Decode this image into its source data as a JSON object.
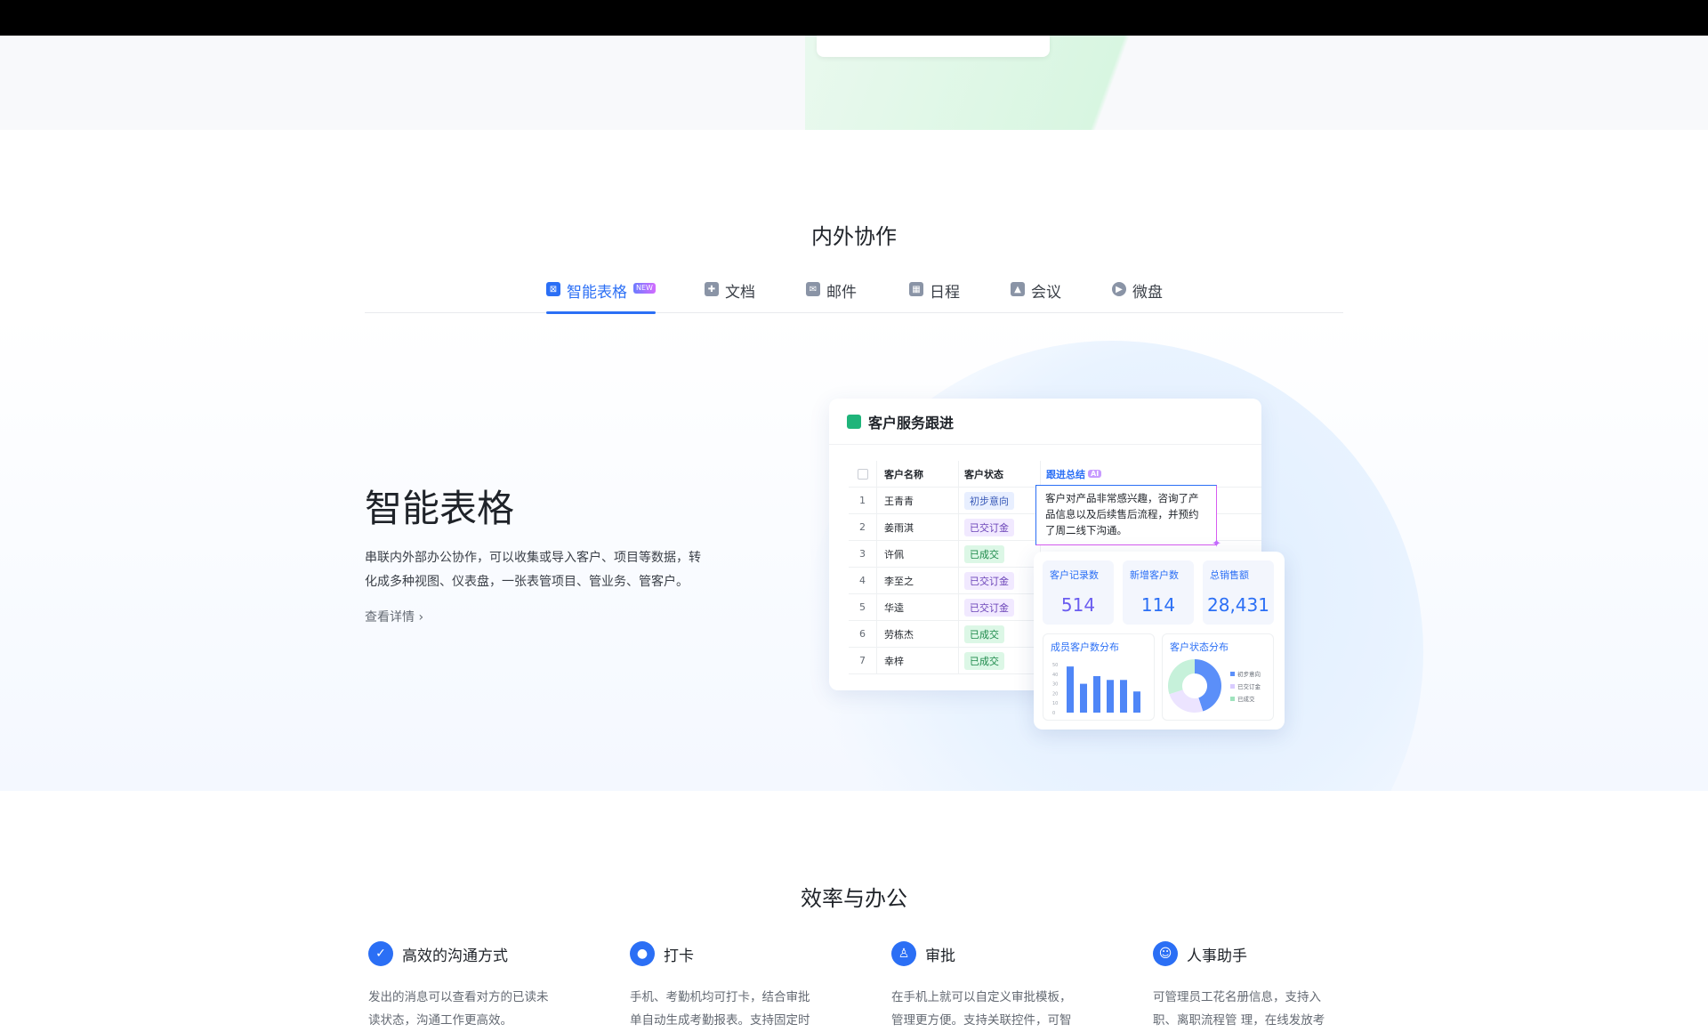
{
  "section1": {
    "title": "内外协作"
  },
  "tabs": [
    {
      "label": "智能表格",
      "badge": "NEW",
      "icon": "smart-sheet-icon",
      "color": "#2b6ff5"
    },
    {
      "label": "文档",
      "icon": "doc-icon",
      "color": "#8a94a6"
    },
    {
      "label": "邮件",
      "icon": "mail-icon",
      "color": "#8a94a6"
    },
    {
      "label": "日程",
      "icon": "calendar-icon",
      "color": "#8a94a6"
    },
    {
      "label": "会议",
      "icon": "meeting-icon",
      "color": "#8a94a6"
    },
    {
      "label": "微盘",
      "icon": "drive-icon",
      "color": "#8a94a6"
    }
  ],
  "feature": {
    "title": "智能表格",
    "desc_line1": "串联内外部办公协作，可以收集或导入客户、项目等数据，转",
    "desc_line2": "化成多种视图、仪表盘，一张表管项目、管业务、管客户。",
    "link": "查看详情 ›"
  },
  "sheet": {
    "title": "客户服务跟进",
    "headers": [
      "客户名称",
      "客户状态",
      "跟进总结"
    ],
    "ai_badge": "AI",
    "rows": [
      {
        "n": "1",
        "name": "王青青",
        "status": "初步意向",
        "cls": "p-a"
      },
      {
        "n": "2",
        "name": "姜雨淇",
        "status": "已交订金",
        "cls": "p-b"
      },
      {
        "n": "3",
        "name": "许佩",
        "status": "已成交",
        "cls": "p-c"
      },
      {
        "n": "4",
        "name": "李至之",
        "status": "已交订金",
        "cls": "p-b"
      },
      {
        "n": "5",
        "name": "华逵",
        "status": "已交订金",
        "cls": "p-b"
      },
      {
        "n": "6",
        "name": "劳栋杰",
        "status": "已成交",
        "cls": "p-c"
      },
      {
        "n": "7",
        "name": "幸梓",
        "status": "已成交",
        "cls": "p-c"
      }
    ],
    "note_line1": "客户对产品非常感兴趣，咨询了产",
    "note_line2": "品信息以及后续售后流程，并预约",
    "note_line3": "了周二线下沟通。"
  },
  "dashboard": {
    "stats": [
      {
        "label": "客户记录数",
        "value": "514",
        "color": "#6a5cf0"
      },
      {
        "label": "新增客户数",
        "value": "114",
        "color": "#2b6ff5"
      },
      {
        "label": "总销售额",
        "value": "28,431",
        "color": "#2b6ff5"
      }
    ],
    "bar_title": "成员客户数分布",
    "pie_title": "客户状态分布",
    "legend": [
      "初步意向",
      "已交订金",
      "已成交"
    ],
    "chart_data": [
      {
        "type": "bar",
        "title": "成员客户数分布",
        "values": [
          48,
          30,
          38,
          34,
          34,
          22
        ],
        "ylim": [
          0,
          50
        ]
      },
      {
        "type": "pie",
        "title": "客户状态分布",
        "categories": [
          "初步意向",
          "已交订金",
          "已成交"
        ],
        "values": [
          45,
          25,
          30
        ],
        "colors": [
          "#5b8ff9",
          "#ece4ff",
          "#c6f1da"
        ]
      }
    ]
  },
  "section2": {
    "title": "效率与办公"
  },
  "efficiency": [
    {
      "title": "高效的沟通方式",
      "icon": "check-icon",
      "line1": "发出的消息可以查看对方的已读未",
      "line2": "读状态，沟通工作更高效。"
    },
    {
      "title": "打卡",
      "icon": "location-pin-icon",
      "line1": "手机、考勤机均可打卡，结合审批",
      "line2": "单自动生成考勤报表。支持固定时"
    },
    {
      "title": "审批",
      "icon": "stamp-icon",
      "line1": "在手机上就可以自定义审批模板，",
      "line2": "管理更方便。支持关联控件，可智"
    },
    {
      "title": "人事助手",
      "icon": "person-icon",
      "line1": "可管理员工花名册信息，支持入",
      "line2": "职、离职流程管 理，在线发放考"
    }
  ]
}
